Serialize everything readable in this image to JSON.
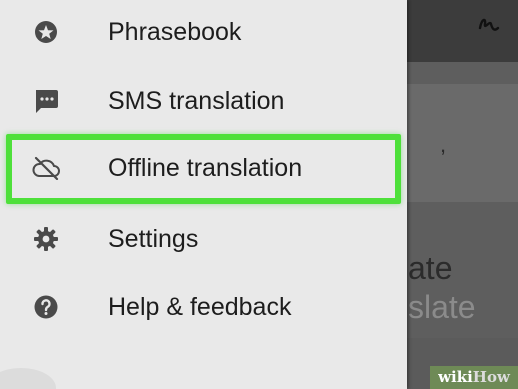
{
  "drawer": {
    "items": [
      {
        "label": "Phrasebook",
        "icon": "star-icon"
      },
      {
        "label": "SMS translation",
        "icon": "message-icon"
      },
      {
        "label": "Offline translation",
        "icon": "cloud-off-icon",
        "highlighted": true
      },
      {
        "label": "Settings",
        "icon": "gear-icon"
      },
      {
        "label": "Help & feedback",
        "icon": "help-icon"
      }
    ]
  },
  "background_app": {
    "text_line_1": "ate",
    "text_line_2": "slate",
    "mark": ","
  },
  "colors": {
    "highlight": "#4ee03a",
    "drawer_bg": "#e9e9e9",
    "icon": "#4a4a4a"
  },
  "watermark": {
    "prefix": "wiki",
    "suffix": "How"
  }
}
